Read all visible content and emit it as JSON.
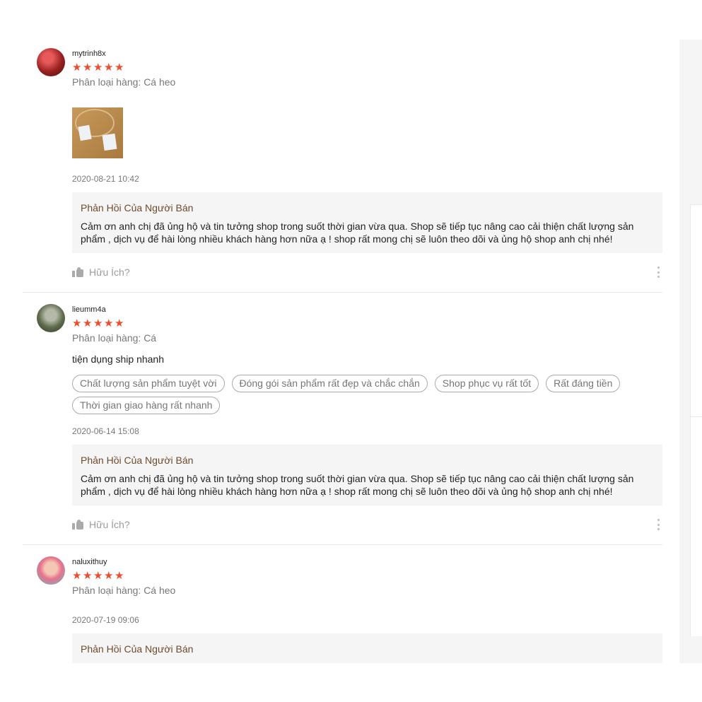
{
  "reviews": [
    {
      "username": "mytrinh8x",
      "rating": 5,
      "variation": "Phân loại hàng: Cá heo",
      "timestamp": "2020-08-21 10:42",
      "reply_title": "Phản Hồi Của Người Bán",
      "reply_text": "Cảm ơn anh chị đã ủng hộ và tin tưởng shop trong suốt thời gian vừa qua. Shop sẽ tiếp tục nâng cao cải thiện chất lượng sản phẩm , dịch vụ để hài lòng nhiều khách hàng hơn nữa ạ ! shop  rất mong chị sẽ luôn theo dõi và ủng hộ shop anh chị nhé!",
      "helpful_label": "Hữu Ích?"
    },
    {
      "username": "lieumm4a",
      "rating": 5,
      "variation": "Phân loại hàng: Cá",
      "comment": "tiện dụng ship nhanh",
      "tags": [
        "Chất lượng sản phẩm tuyệt vời",
        "Đóng gói sản phẩm rất đẹp và chắc chắn",
        "Shop phục vụ rất tốt",
        "Rất đáng tiền",
        "Thời gian giao hàng rất nhanh"
      ],
      "timestamp": "2020-06-14 15:08",
      "reply_title": "Phản Hồi Của Người Bán",
      "reply_text": "Cảm ơn anh chị đã ủng hộ và tin tưởng shop trong suốt thời gian vừa qua. Shop sẽ tiếp tục nâng cao cải thiện chất lượng sản phẩm , dịch vụ để hài lòng nhiều khách hàng hơn nữa ạ ! shop  rất mong chị sẽ luôn theo dõi và ủng hộ shop anh chị nhé!",
      "helpful_label": "Hữu Ích?"
    },
    {
      "username": "naluxithuy",
      "rating": 5,
      "variation": "Phân loại hàng: Cá heo",
      "timestamp": "2020-07-19 09:06",
      "reply_title": "Phản Hồi Của Người Bán"
    }
  ],
  "colors": {
    "star": "#ee4d2d",
    "reply_title": "#6d4b2b",
    "reply_bg": "#f5f5f5"
  },
  "icons": {
    "star": "star-icon",
    "thumbs_up": "thumbs-up-icon",
    "more": "more-vertical-icon"
  }
}
